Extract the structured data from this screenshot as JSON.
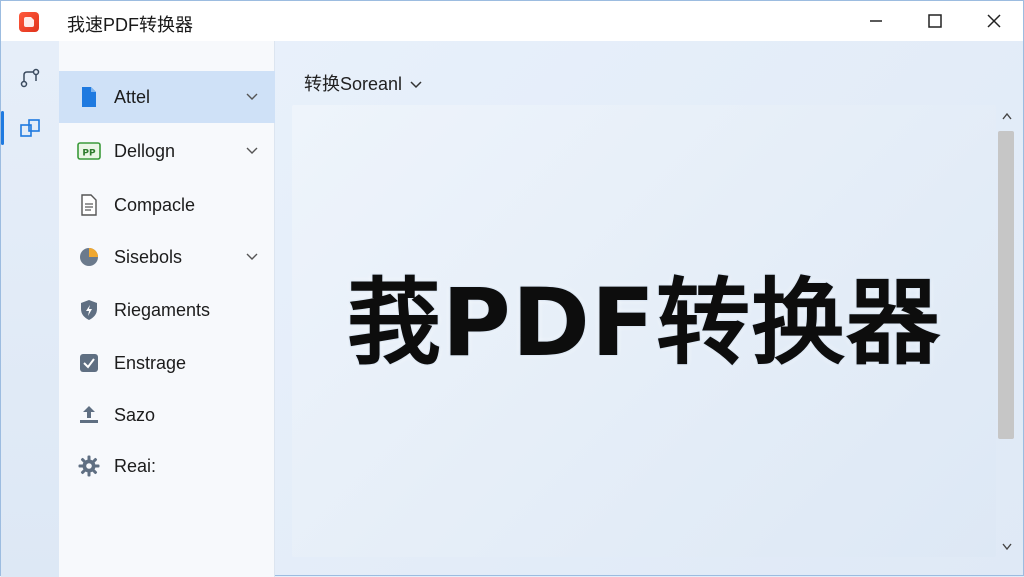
{
  "window": {
    "title": "我速PDF转换器"
  },
  "rail": {
    "items": [
      {
        "icon": "flow-icon"
      },
      {
        "icon": "convert-icon"
      }
    ]
  },
  "sidebar": {
    "items": [
      {
        "label": "Attel",
        "icon": "file-icon",
        "expandable": true
      },
      {
        "label": "Dellogn",
        "icon": "ppt-icon",
        "expandable": true
      },
      {
        "label": "Compacle",
        "icon": "document-icon",
        "expandable": false
      },
      {
        "label": "Sisebols",
        "icon": "pie-chart-icon",
        "expandable": true
      },
      {
        "label": "Riegaments",
        "icon": "shield-icon",
        "expandable": false
      },
      {
        "label": "Enstrage",
        "icon": "checkbox-icon",
        "expandable": false
      },
      {
        "label": "Sazo",
        "icon": "upload-icon",
        "expandable": false
      },
      {
        "label": "Reai:",
        "icon": "gear-icon",
        "expandable": false
      }
    ]
  },
  "content": {
    "dropdown_label": "转换Soreanl",
    "hero_text": "莪PDF转换器"
  },
  "colors": {
    "accent": "#1f7ae0",
    "active_item_bg": "#cfe1f7"
  }
}
